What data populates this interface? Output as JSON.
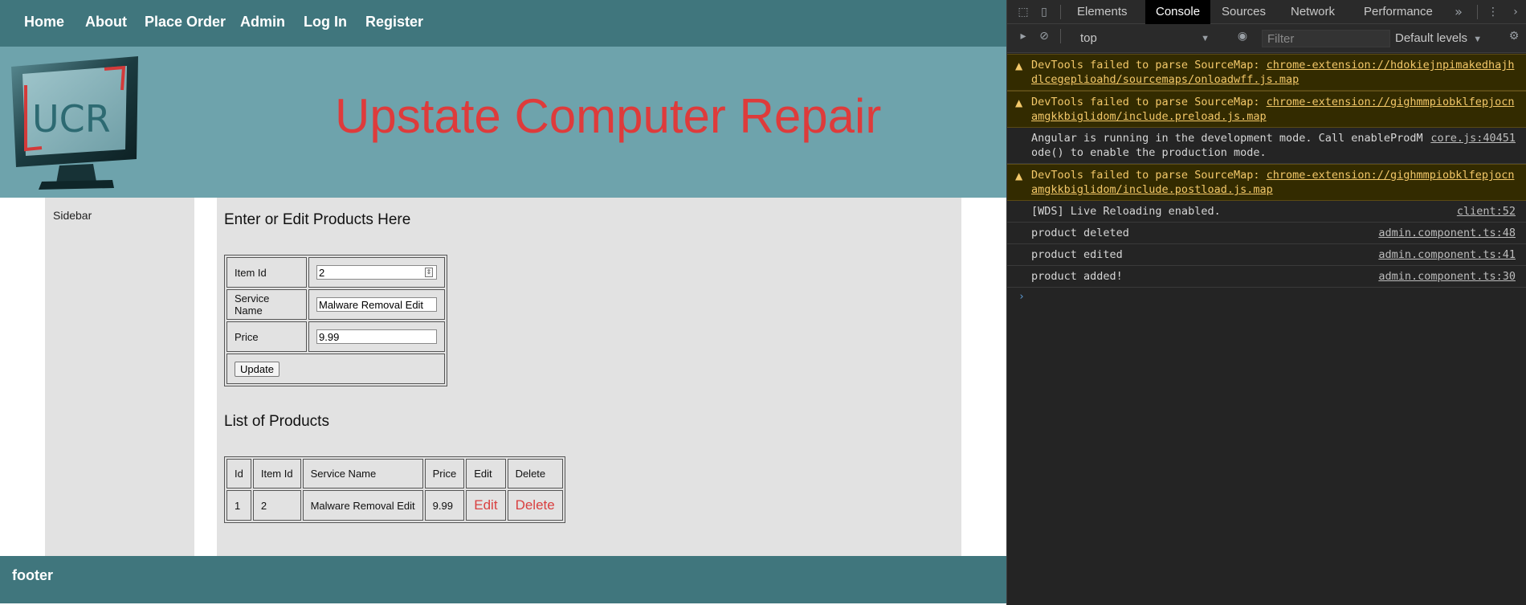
{
  "nav": {
    "home": "Home",
    "about": "About",
    "place_order": "Place Order",
    "admin": "Admin",
    "log_in": "Log In",
    "register": "Register"
  },
  "banner": {
    "logo_text": "UCR",
    "title": "Upstate Computer Repair"
  },
  "sidebar": {
    "label": "Sidebar"
  },
  "form": {
    "heading": "Enter or Edit Products Here",
    "item_id_label": "Item Id",
    "item_id_value": "2",
    "service_name_label": "Service Name",
    "service_name_value": "Malware Removal Edit",
    "price_label": "Price",
    "price_value": "9.99",
    "update_button": "Update"
  },
  "products": {
    "heading": "List of Products",
    "columns": [
      "Id",
      "Item Id",
      "Service Name",
      "Price",
      "Edit",
      "Delete"
    ],
    "rows": [
      {
        "id": "1",
        "item_id": "2",
        "service_name": "Malware Removal Edit",
        "price": "9.99",
        "edit": "Edit",
        "delete": "Delete"
      }
    ]
  },
  "footer": {
    "text": "footer"
  },
  "devtools": {
    "tabs": [
      "Elements",
      "Console",
      "Sources",
      "Network",
      "Performance"
    ],
    "active_tab": "Console",
    "more_tabs": "»",
    "context": "top",
    "filter_placeholder": "Filter",
    "levels": "Default levels",
    "messages": [
      {
        "level": "warning",
        "text": "DevTools failed to parse SourceMap: ",
        "link": "chrome-extension://hdokiejnpimakedhajhdlcegeplioahd/sourcemaps/onloadwff.js.map",
        "source": ""
      },
      {
        "level": "warning",
        "text": "DevTools failed to parse SourceMap: ",
        "link": "chrome-extension://gighmmpiobklfepjocnamgkkbiglidom/include.preload.js.map",
        "source": ""
      },
      {
        "level": "info",
        "text": "Angular is running in the development mode. Call enableProdMode() to enable the production mode.",
        "link": "",
        "source": "core.js:40451"
      },
      {
        "level": "warning",
        "text": "DevTools failed to parse SourceMap: ",
        "link": "chrome-extension://gighmmpiobklfepjocnamgkkbiglidom/include.postload.js.map",
        "source": ""
      },
      {
        "level": "info",
        "text": "[WDS] Live Reloading enabled.",
        "link": "",
        "source": "client:52"
      },
      {
        "level": "info",
        "text": "product deleted",
        "link": "",
        "source": "admin.component.ts:48"
      },
      {
        "level": "info",
        "text": "product edited",
        "link": "",
        "source": "admin.component.ts:41"
      },
      {
        "level": "info",
        "text": "product added!",
        "link": "",
        "source": "admin.component.ts:30"
      }
    ],
    "prompt": "›"
  },
  "colors": {
    "nav_bg": "#40767d",
    "banner_bg": "#6ea3ac",
    "title_red": "#de3b3b",
    "content_bg": "#e2e2e2",
    "devtools_bg": "#242424",
    "warning_bg": "#332b00"
  }
}
